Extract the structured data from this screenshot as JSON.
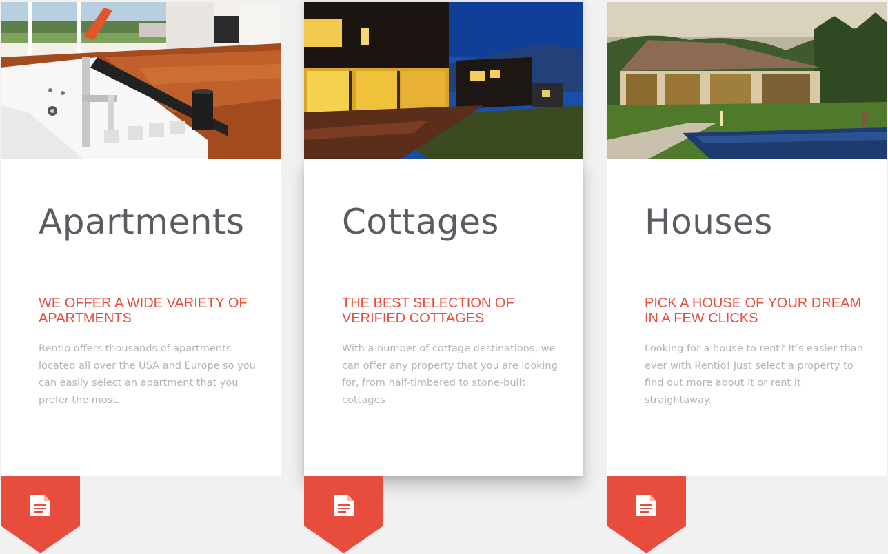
{
  "accent_color": "#e84c3d",
  "cards": [
    {
      "title": "Apartments",
      "subtitle": "WE OFFER A WIDE VARIETY OF APARTMENTS",
      "description": "Rentio offers thousands of apartments located all over the USA and Europe so you can easily select an apartment that you prefer the most.",
      "icon": "document-icon",
      "image": "apartment-interior-photo"
    },
    {
      "title": "Cottages",
      "subtitle": "THE BEST SELECTION OF VERIFIED COTTAGES",
      "description": "With a number of cottage destinations, we can offer any property that you are looking for, from half-timbered to stone-built cottages.",
      "icon": "document-icon",
      "image": "cottage-at-night-photo"
    },
    {
      "title": "Houses",
      "subtitle": "PICK A HOUSE OF YOUR DREAM IN A FEW CLICKS",
      "description": "Looking for a house to rent? It’s easier than ever with Rentio! Just select a property to find out more about it or rent it straightaway.",
      "icon": "document-icon",
      "image": "house-with-pool-photo"
    }
  ]
}
